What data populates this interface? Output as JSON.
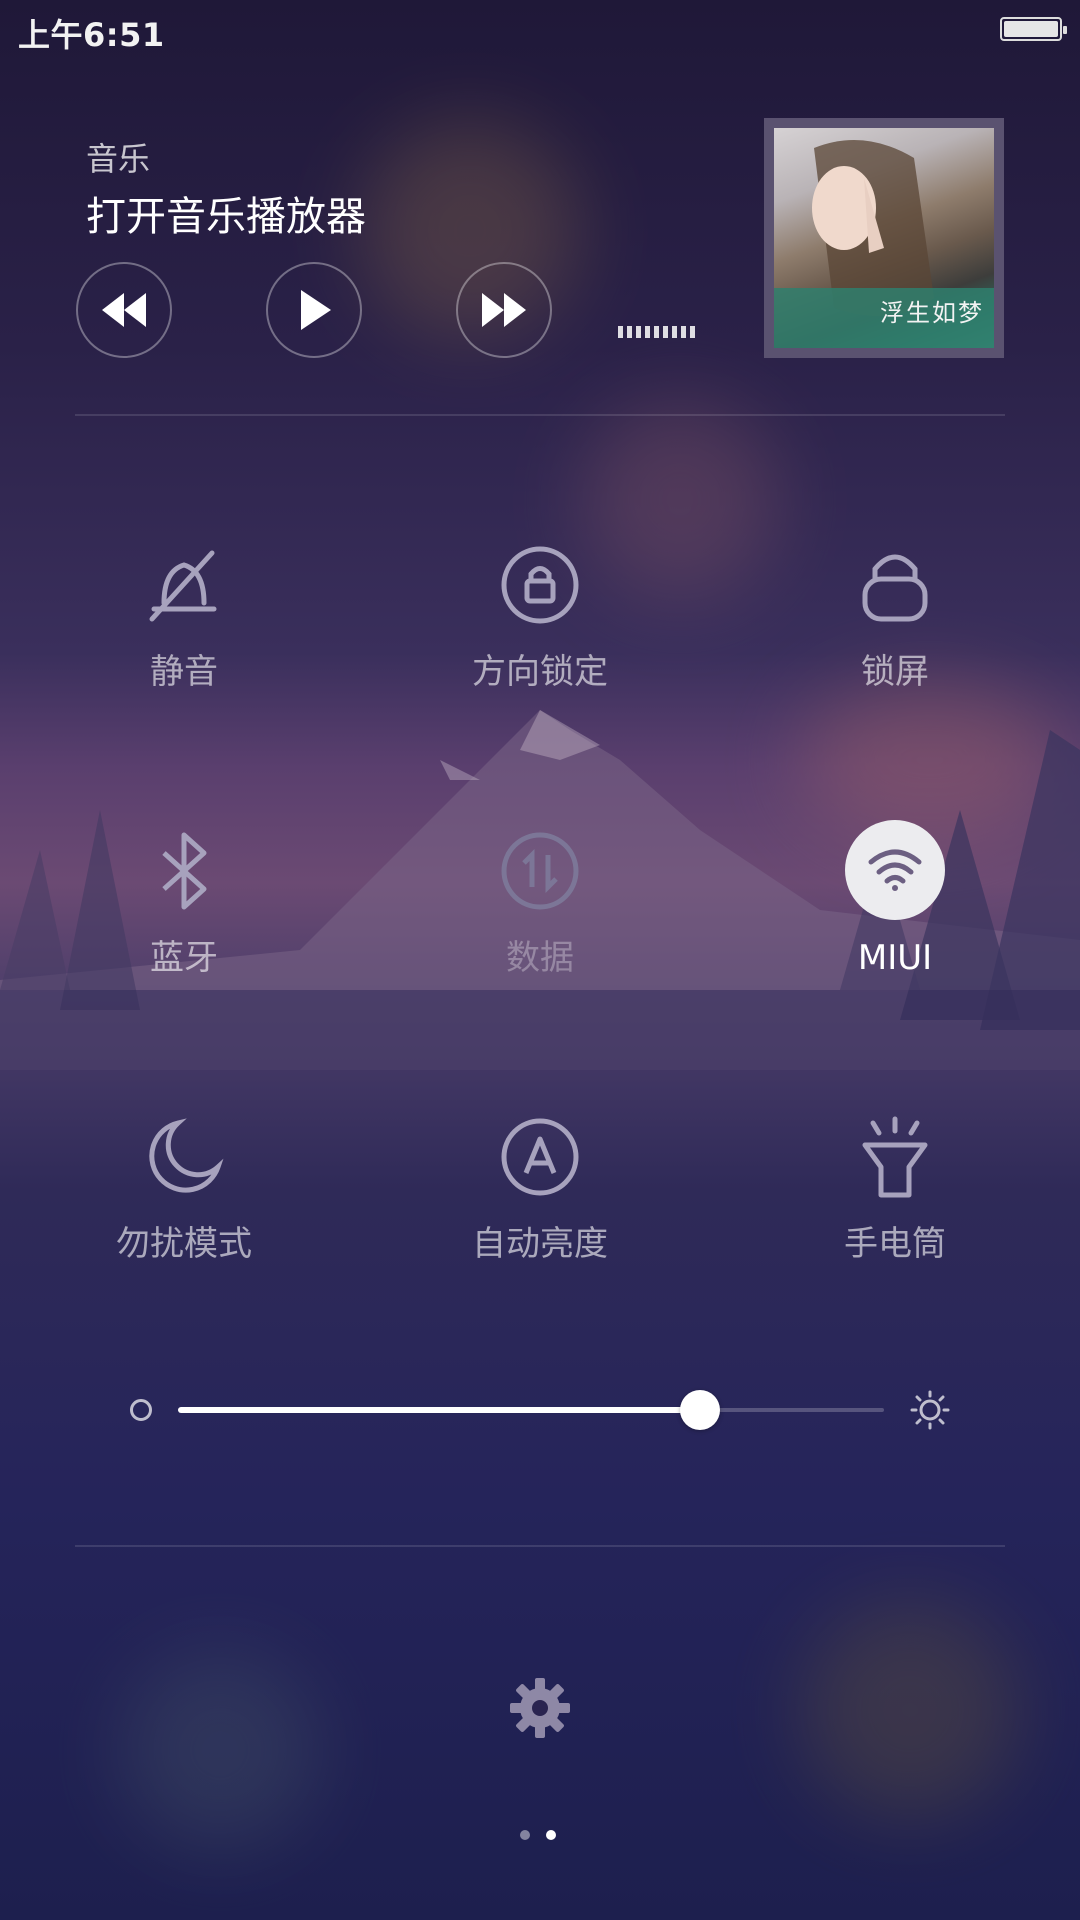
{
  "status_bar": {
    "time": "上午6:51",
    "battery_level": 1.0
  },
  "music": {
    "app_label": "音乐",
    "title": "打开音乐播放器",
    "album_caption": "浮生如梦",
    "controls": [
      "previous-icon",
      "play-icon",
      "next-icon"
    ]
  },
  "toggles": [
    {
      "label": "静音",
      "icon": "silent-bell-icon",
      "state": "off"
    },
    {
      "label": "方向锁定",
      "icon": "rotation-lock-icon",
      "state": "off"
    },
    {
      "label": "锁屏",
      "icon": "lock-icon",
      "state": "off"
    },
    {
      "label": "蓝牙",
      "icon": "bluetooth-icon",
      "state": "off"
    },
    {
      "label": "数据",
      "icon": "mobile-data-icon",
      "state": "disabled"
    },
    {
      "label": "MIUI",
      "icon": "wifi-icon",
      "state": "on"
    },
    {
      "label": "勿扰模式",
      "icon": "moon-icon",
      "state": "off"
    },
    {
      "label": "自动亮度",
      "icon": "auto-brightness-icon",
      "state": "off"
    },
    {
      "label": "手电筒",
      "icon": "flashlight-icon",
      "state": "off"
    }
  ],
  "brightness": {
    "level": 0.74
  },
  "settings": {
    "icon": "gear-icon"
  },
  "pager": {
    "count": 2,
    "active_index": 1
  },
  "colors": {
    "accent": "#ffffff",
    "inactive": "#9c97b0",
    "background": "#2a2148"
  }
}
